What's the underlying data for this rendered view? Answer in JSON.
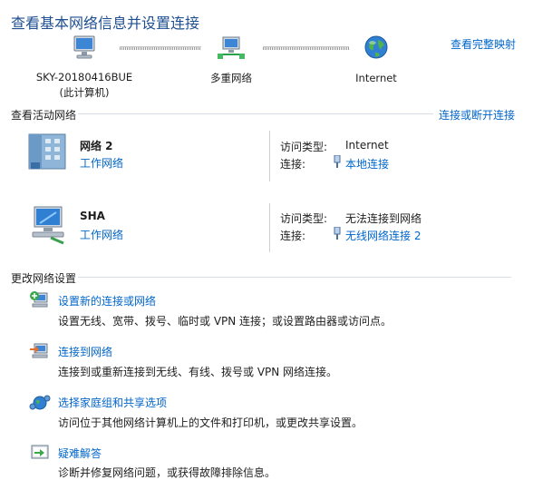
{
  "header": {
    "title": "查看基本网络信息并设置连接",
    "full_map_link": "查看完整映射"
  },
  "map": {
    "computer_name": "SKY-20180416BUE",
    "computer_sub": "(此计算机)",
    "middle_label": "多重网络",
    "internet_label": "Internet"
  },
  "active": {
    "header": "查看活动网络",
    "connect_link": "连接或断开连接",
    "networks": [
      {
        "name": "网络  2",
        "type": "工作网络",
        "access_label": "访问类型:",
        "access_value": "Internet",
        "conn_label": "连接:",
        "conn_value": "本地连接"
      },
      {
        "name": "SHA",
        "type": "工作网络",
        "access_label": "访问类型:",
        "access_value": "无法连接到网络",
        "conn_label": "连接:",
        "conn_value": "无线网络连接 2"
      }
    ]
  },
  "change": {
    "header": "更改网络设置",
    "tasks": [
      {
        "title": "设置新的连接或网络",
        "desc": "设置无线、宽带、拨号、临时或 VPN 连接；或设置路由器或访问点。"
      },
      {
        "title": "连接到网络",
        "desc": "连接到或重新连接到无线、有线、拨号或 VPN 网络连接。"
      },
      {
        "title": "选择家庭组和共享选项",
        "desc": "访问位于其他网络计算机上的文件和打印机，或更改共享设置。"
      },
      {
        "title": "疑难解答",
        "desc": "诊断并修复网络问题，或获得故障排除信息。"
      }
    ]
  },
  "colors": {
    "link": "#0066cc",
    "title": "#1e4f91"
  }
}
